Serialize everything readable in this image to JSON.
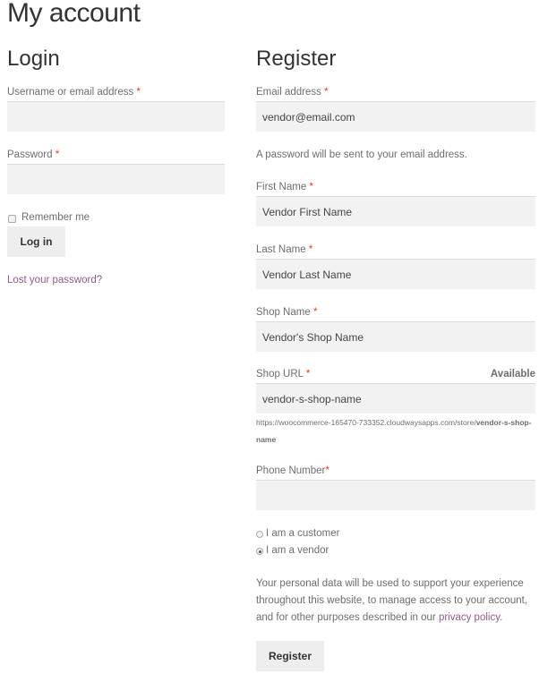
{
  "page_title": "My account",
  "login": {
    "title": "Login",
    "username_label": "Username or email address",
    "username_value": "",
    "password_label": "Password",
    "password_value": "",
    "required_mark": "*",
    "remember_label": "Remember me",
    "remember_checked": false,
    "login_button": "Log in",
    "lost_password": "Lost your password?"
  },
  "register": {
    "title": "Register",
    "required_mark": "*",
    "email_label": "Email address",
    "email_value": "vendor@email.com",
    "password_note": "A password will be sent to your email address.",
    "first_name_label": "First Name",
    "first_name_value": "Vendor First Name",
    "last_name_label": "Last Name",
    "last_name_value": "Vendor Last Name",
    "shop_name_label": "Shop Name",
    "shop_name_value": "Vendor's Shop Name",
    "shop_url_label": "Shop URL",
    "shop_url_status": "Available",
    "shop_url_value": "vendor-s-shop-name",
    "shop_url_prefix": "https://woocommerce-165470-733352.cloudwaysapps.com/store/",
    "shop_url_slug": "vendor-s-shop-",
    "shop_url_slug_rest": "name",
    "phone_label": "Phone Number",
    "phone_value": "",
    "role_customer": "I am a customer",
    "role_vendor": "I am a vendor",
    "selected_role": "vendor",
    "privacy_text": "Your personal data will be used to support your experience throughout this website, to manage access to your account, and for other purposes described in our ",
    "privacy_link": "privacy policy",
    "privacy_end": ".",
    "register_button": "Register"
  }
}
